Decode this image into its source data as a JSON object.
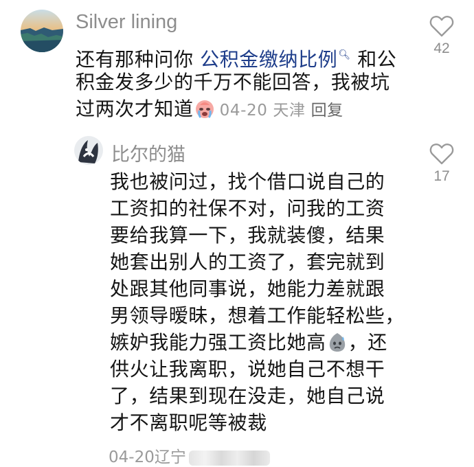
{
  "comment": {
    "username": "Silver lining",
    "text_part1": "还有那种问你 ",
    "keyword": "公积金缴纳比例",
    "text_part2": " 和公",
    "line2": "积金发多少的千万不能回答，我被坑",
    "line3": "过两次才知道",
    "date": "04-20",
    "location": "天津",
    "reply_label": "回复",
    "likes": "42"
  },
  "reply": {
    "username": "比尔的猫",
    "lines": [
      "我也被问过，找个借口说自己的",
      "工资扣的社保不对，问我的工资",
      "要给我算一下，我就装傻，结果",
      "她套出别人的工资了，套完就到",
      "处跟其他同事说，她能力差就跟",
      "男领导暧昧，想着工作能轻松些，",
      "嫉妒我能力强工资比她高",
      "供火让我离职，说她自己不想干",
      "了，结果到现在没走，她自己说",
      "才不离职呢等被裁"
    ],
    "line7_tail": "，还",
    "date": "04-20",
    "location": "辽宁",
    "likes": "17"
  },
  "icons": {
    "like": "heart-outline-icon",
    "search_hint": "search-hint-icon",
    "emoji_cry": "crying-face-emoji",
    "emoji_sigh": "sweat-face-emoji"
  },
  "colors": {
    "keyword": "#1e3d8a",
    "muted": "#8d8d8d",
    "text": "#151515"
  }
}
